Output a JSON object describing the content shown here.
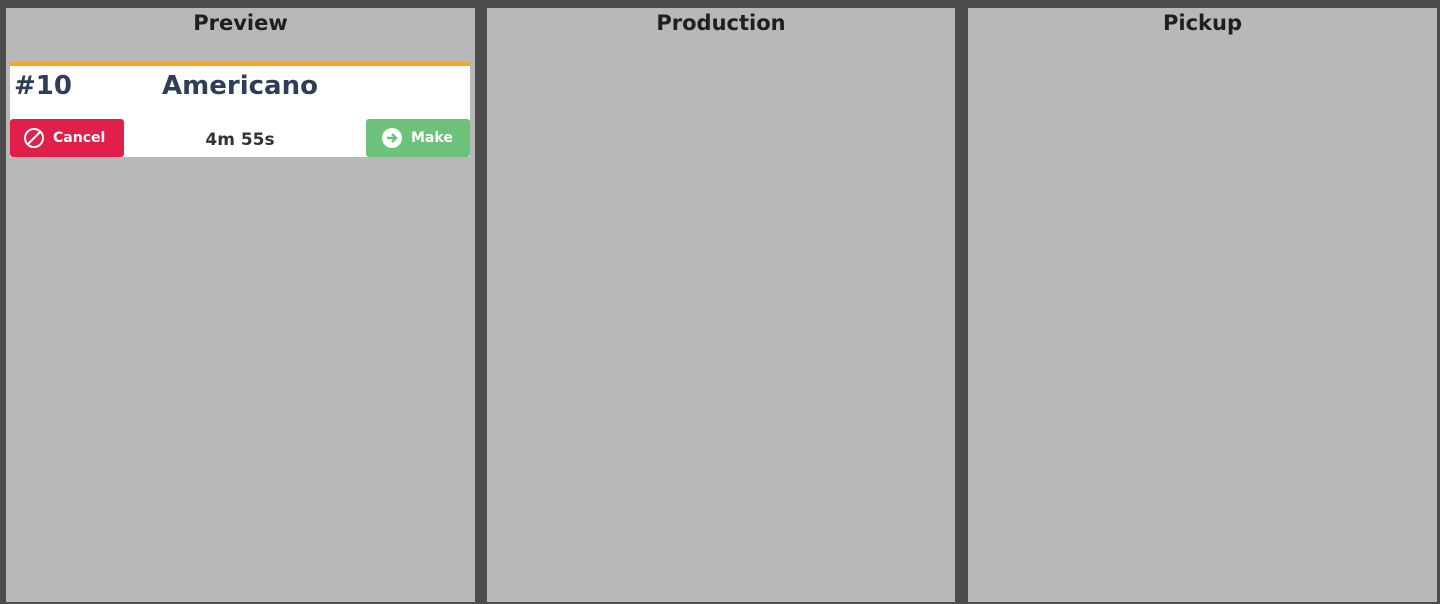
{
  "columns": {
    "preview": {
      "title": "Preview"
    },
    "production": {
      "title": "Production"
    },
    "pickup": {
      "title": "Pickup"
    }
  },
  "orders": [
    {
      "number": "#10",
      "item": "Americano",
      "elapsed": "4m 55s",
      "cancel_label": "Cancel",
      "make_label": "Make",
      "cancel_icon": "ban-icon",
      "make_icon": "arrow-right-circle-icon"
    }
  ],
  "colors": {
    "background": "#4d4d4d",
    "column": "#b8b8b8",
    "card_accent": "#f5a623",
    "cancel": "#e0204a",
    "make": "#6cc27a",
    "order_text": "#2c3e58"
  }
}
